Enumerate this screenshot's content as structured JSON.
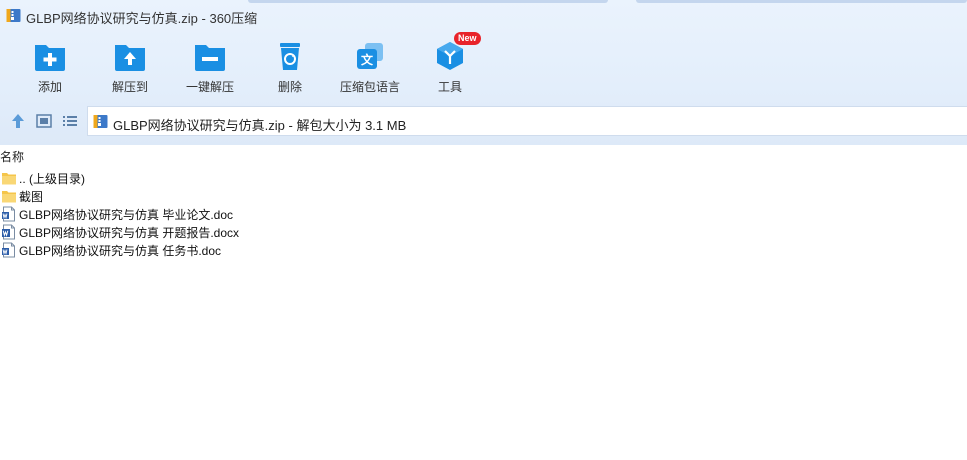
{
  "window": {
    "title": "GLBP网络协议研究与仿真.zip - 360压缩"
  },
  "toolbar": {
    "buttons": [
      {
        "label": "添加",
        "icon": "add-icon"
      },
      {
        "label": "解压到",
        "icon": "extract-to-icon"
      },
      {
        "label": "一键解压",
        "icon": "one-click-extract-icon"
      },
      {
        "label": "删除",
        "icon": "recycle-bin-icon"
      },
      {
        "label": "压缩包语言",
        "icon": "language-icon"
      },
      {
        "label": "工具",
        "icon": "tools-icon"
      }
    ],
    "new_badge": "New"
  },
  "address": {
    "path": "GLBP网络协议研究与仿真.zip - 解包大小为 3.1 MB"
  },
  "list": {
    "column_name": "名称",
    "items": [
      {
        "name": ".. (上级目录)",
        "type": "folder"
      },
      {
        "name": "截图",
        "type": "folder"
      },
      {
        "name": "GLBP网络协议研究与仿真 毕业论文.doc",
        "type": "doc"
      },
      {
        "name": "GLBP网络协议研究与仿真 开题报告.docx",
        "type": "docx"
      },
      {
        "name": "GLBP网络协议研究与仿真 任务书.doc",
        "type": "doc"
      }
    ]
  },
  "colors": {
    "accent": "#1a8fe3",
    "badge": "#e8232a",
    "folder": "#f5c54a",
    "toolbar_bg": "#e3eefb"
  }
}
